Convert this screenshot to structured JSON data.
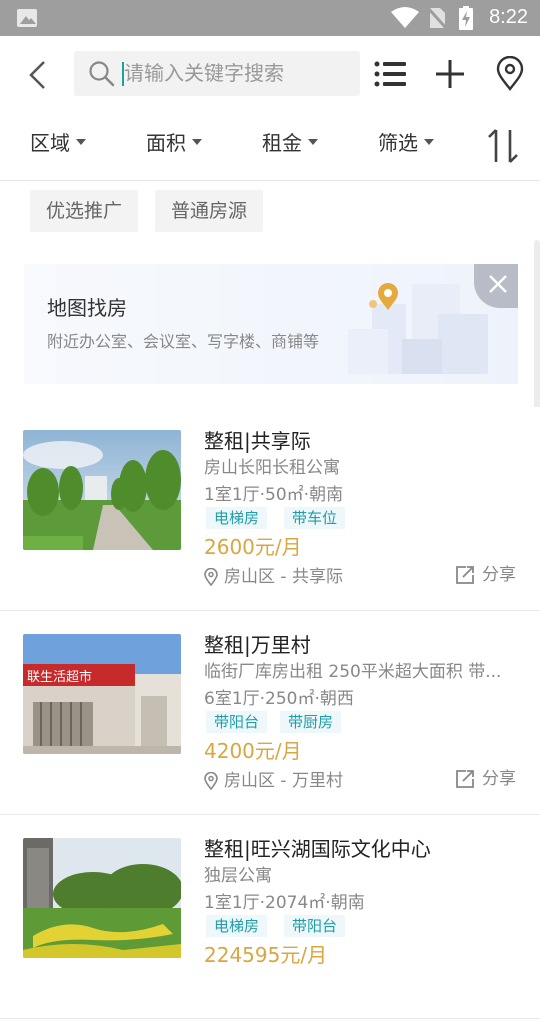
{
  "status_bar": {
    "time": "8:22"
  },
  "search": {
    "placeholder": "请输入关键字搜索"
  },
  "filters": [
    {
      "label": "区域"
    },
    {
      "label": "面积"
    },
    {
      "label": "租金"
    },
    {
      "label": "筛选"
    }
  ],
  "tags": [
    "优选推广",
    "普通房源"
  ],
  "map_banner": {
    "title": "地图找房",
    "subtitle": "附近办公室、会议室、写字楼、商铺等"
  },
  "listings": [
    {
      "title": "整租|共享际",
      "subtitle": "房山长阳长租公寓",
      "spec": "1室1厅·50㎡·朝南",
      "features": [
        "电梯房",
        "带车位"
      ],
      "price": "2600元/月",
      "location": "房山区 - 共享际",
      "share": "分享",
      "image": "tree-lined-path-photo"
    },
    {
      "title": "整租|万里村",
      "subtitle": "临街厂库房出租 250平米超大面积 带...",
      "spec": "6室1厅·250㎡·朝西",
      "features": [
        "带阳台",
        "带厨房"
      ],
      "price": "4200元/月",
      "location": "房山区 - 万里村",
      "share": "分享",
      "image": "supermarket-building-photo"
    },
    {
      "title": "整租|旺兴湖国际文化中心",
      "subtitle": "独层公寓",
      "spec": "1室1厅·2074㎡·朝南",
      "features": [
        "电梯房",
        "带阳台"
      ],
      "price": "224595元/月",
      "location": "",
      "share": "",
      "image": "garden-hedge-photo"
    }
  ],
  "colors": {
    "accent_price": "#d9a641",
    "feature_tag_text": "#1e9ea8",
    "status_bar": "#9e9e9e",
    "cursor": "#1aa39a"
  }
}
